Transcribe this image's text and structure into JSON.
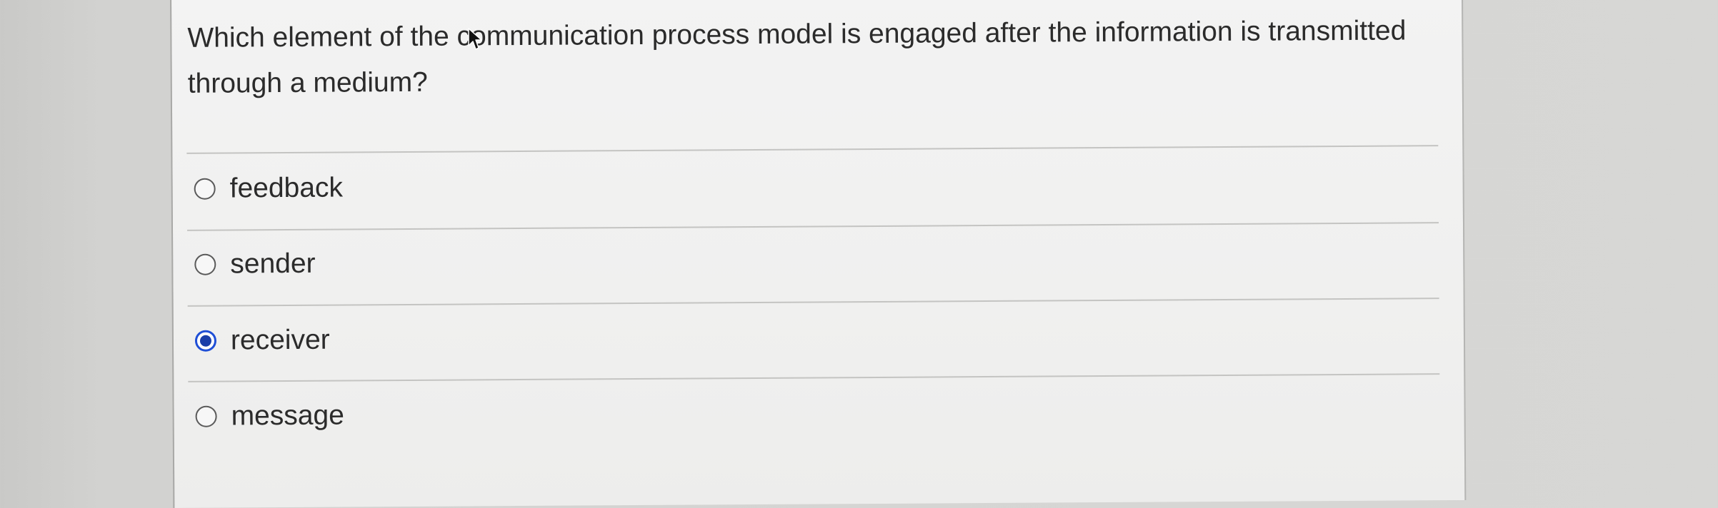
{
  "question": {
    "text": "Which element of the communication process model is engaged after the information is transmitted through a medium?"
  },
  "options": [
    {
      "label": "feedback",
      "selected": false
    },
    {
      "label": "sender",
      "selected": false
    },
    {
      "label": "receiver",
      "selected": true
    },
    {
      "label": "message",
      "selected": false
    }
  ],
  "colors": {
    "selected_radio": "#1f4fd6",
    "text": "#2b2b2b",
    "panel_background": "#f1f1f0",
    "page_background": "#d3d3d1"
  }
}
